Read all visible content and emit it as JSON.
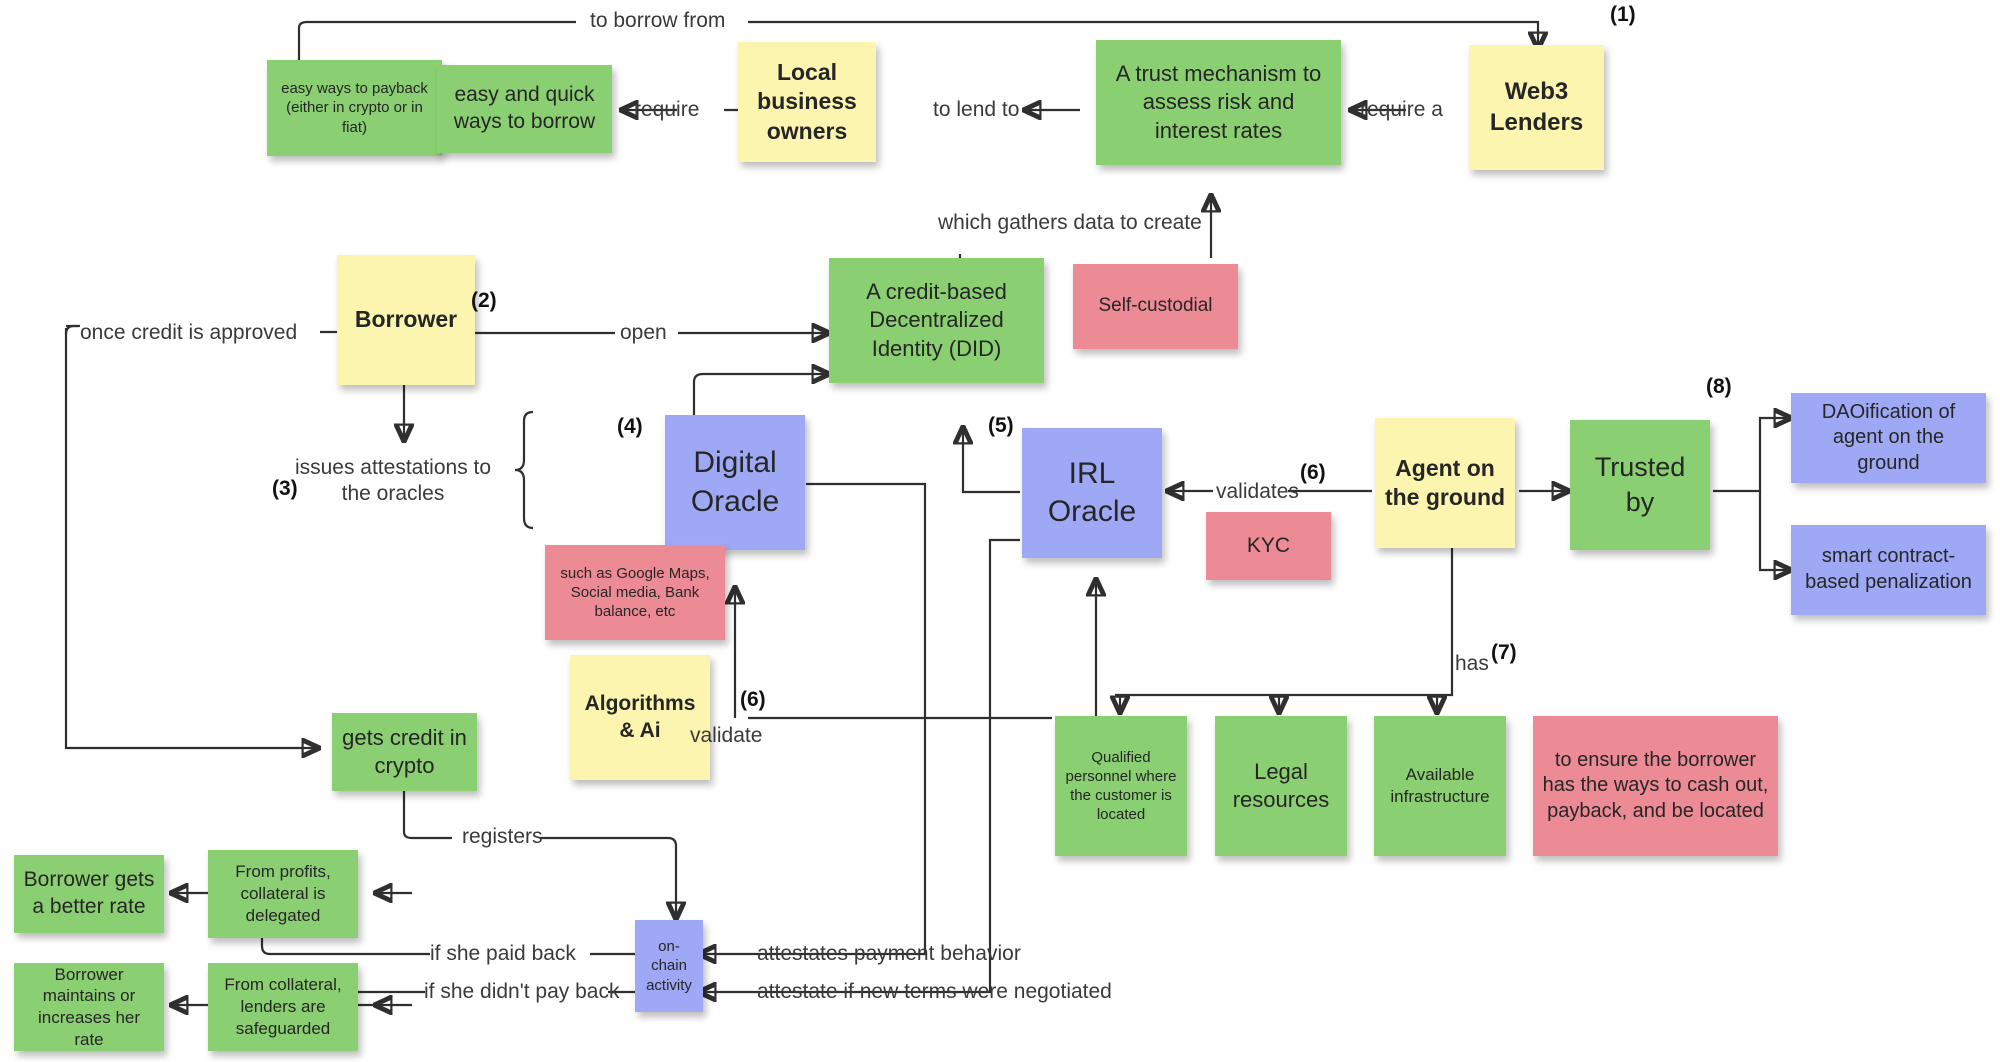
{
  "diagram": {
    "title": "Web3 lending / decentralized credit flow",
    "colors": {
      "green": "#8ACF72",
      "yellow": "#FBF5AF",
      "blue": "#9FA8F5",
      "pink": "#EC8A95",
      "line": "#2f2f2f",
      "text": "#2b2b2b"
    },
    "steps": {
      "s1": "(1)",
      "s2": "(2)",
      "s3": "(3)",
      "s4": "(4)",
      "s5": "(5)",
      "s6a": "(6)",
      "s6b": "(6)",
      "s7": "(7)",
      "s8": "(8)"
    },
    "notes": {
      "easy_payback": "easy ways to payback (either in crypto or in fiat)",
      "easy_borrow": "easy and quick ways to borrow",
      "local_business": "Local business owners",
      "trust_mechanism": "A trust mechanism to assess risk and interest rates",
      "web3_lenders": "Web3 Lenders",
      "borrower": "Borrower",
      "did": "A credit-based Decentralized Identity (DID)",
      "self_custodial": "Self-custodial",
      "digital_oracle": "Digital Oracle",
      "such_as": "such as Google Maps, Social media, Bank balance, etc",
      "algorithms_ai": "Algorithms & Ai",
      "irl_oracle": "IRL Oracle",
      "kyc": "KYC",
      "agent_ground": "Agent on the ground",
      "trusted_by": "Trusted by",
      "daoification": "DAOification of agent on the ground",
      "smart_contract": "smart contract-based penalization",
      "qualified_personnel": "Qualified personnel where the customer is located",
      "legal_resources": "Legal resources",
      "available_infrastructure": "Available infrastructure",
      "to_ensure": "to ensure the borrower has the ways to cash out, payback, and be located",
      "gets_credit": "gets credit in crypto",
      "onchain_activity": "on-chain activity",
      "borrower_better_rate": "Borrower gets a better rate",
      "from_profits": "From profits, collateral is delegated",
      "borrower_maintains": "Borrower maintains or increases her rate",
      "from_collateral": "From collateral, lenders are safeguarded"
    },
    "edge_labels": {
      "to_borrow_from": "to borrow from",
      "require": "require",
      "to_lend_to": "to lend to",
      "require_a": "require a",
      "once_credit_approved": "once credit is approved",
      "open": "open",
      "which_gathers": "which gathers data to create",
      "issues_attestations": "issues attestations to the oracles",
      "validates": "validates",
      "validate": "validate",
      "has": "has",
      "registers": "registers",
      "if_she_paid_back": "if she paid back",
      "if_she_didnt_pay_back": "if she didn't pay back",
      "attestates_payment_behavior": "attestates payment behavior",
      "attestate_new_terms": "attestate if new terms were negotiated"
    }
  }
}
